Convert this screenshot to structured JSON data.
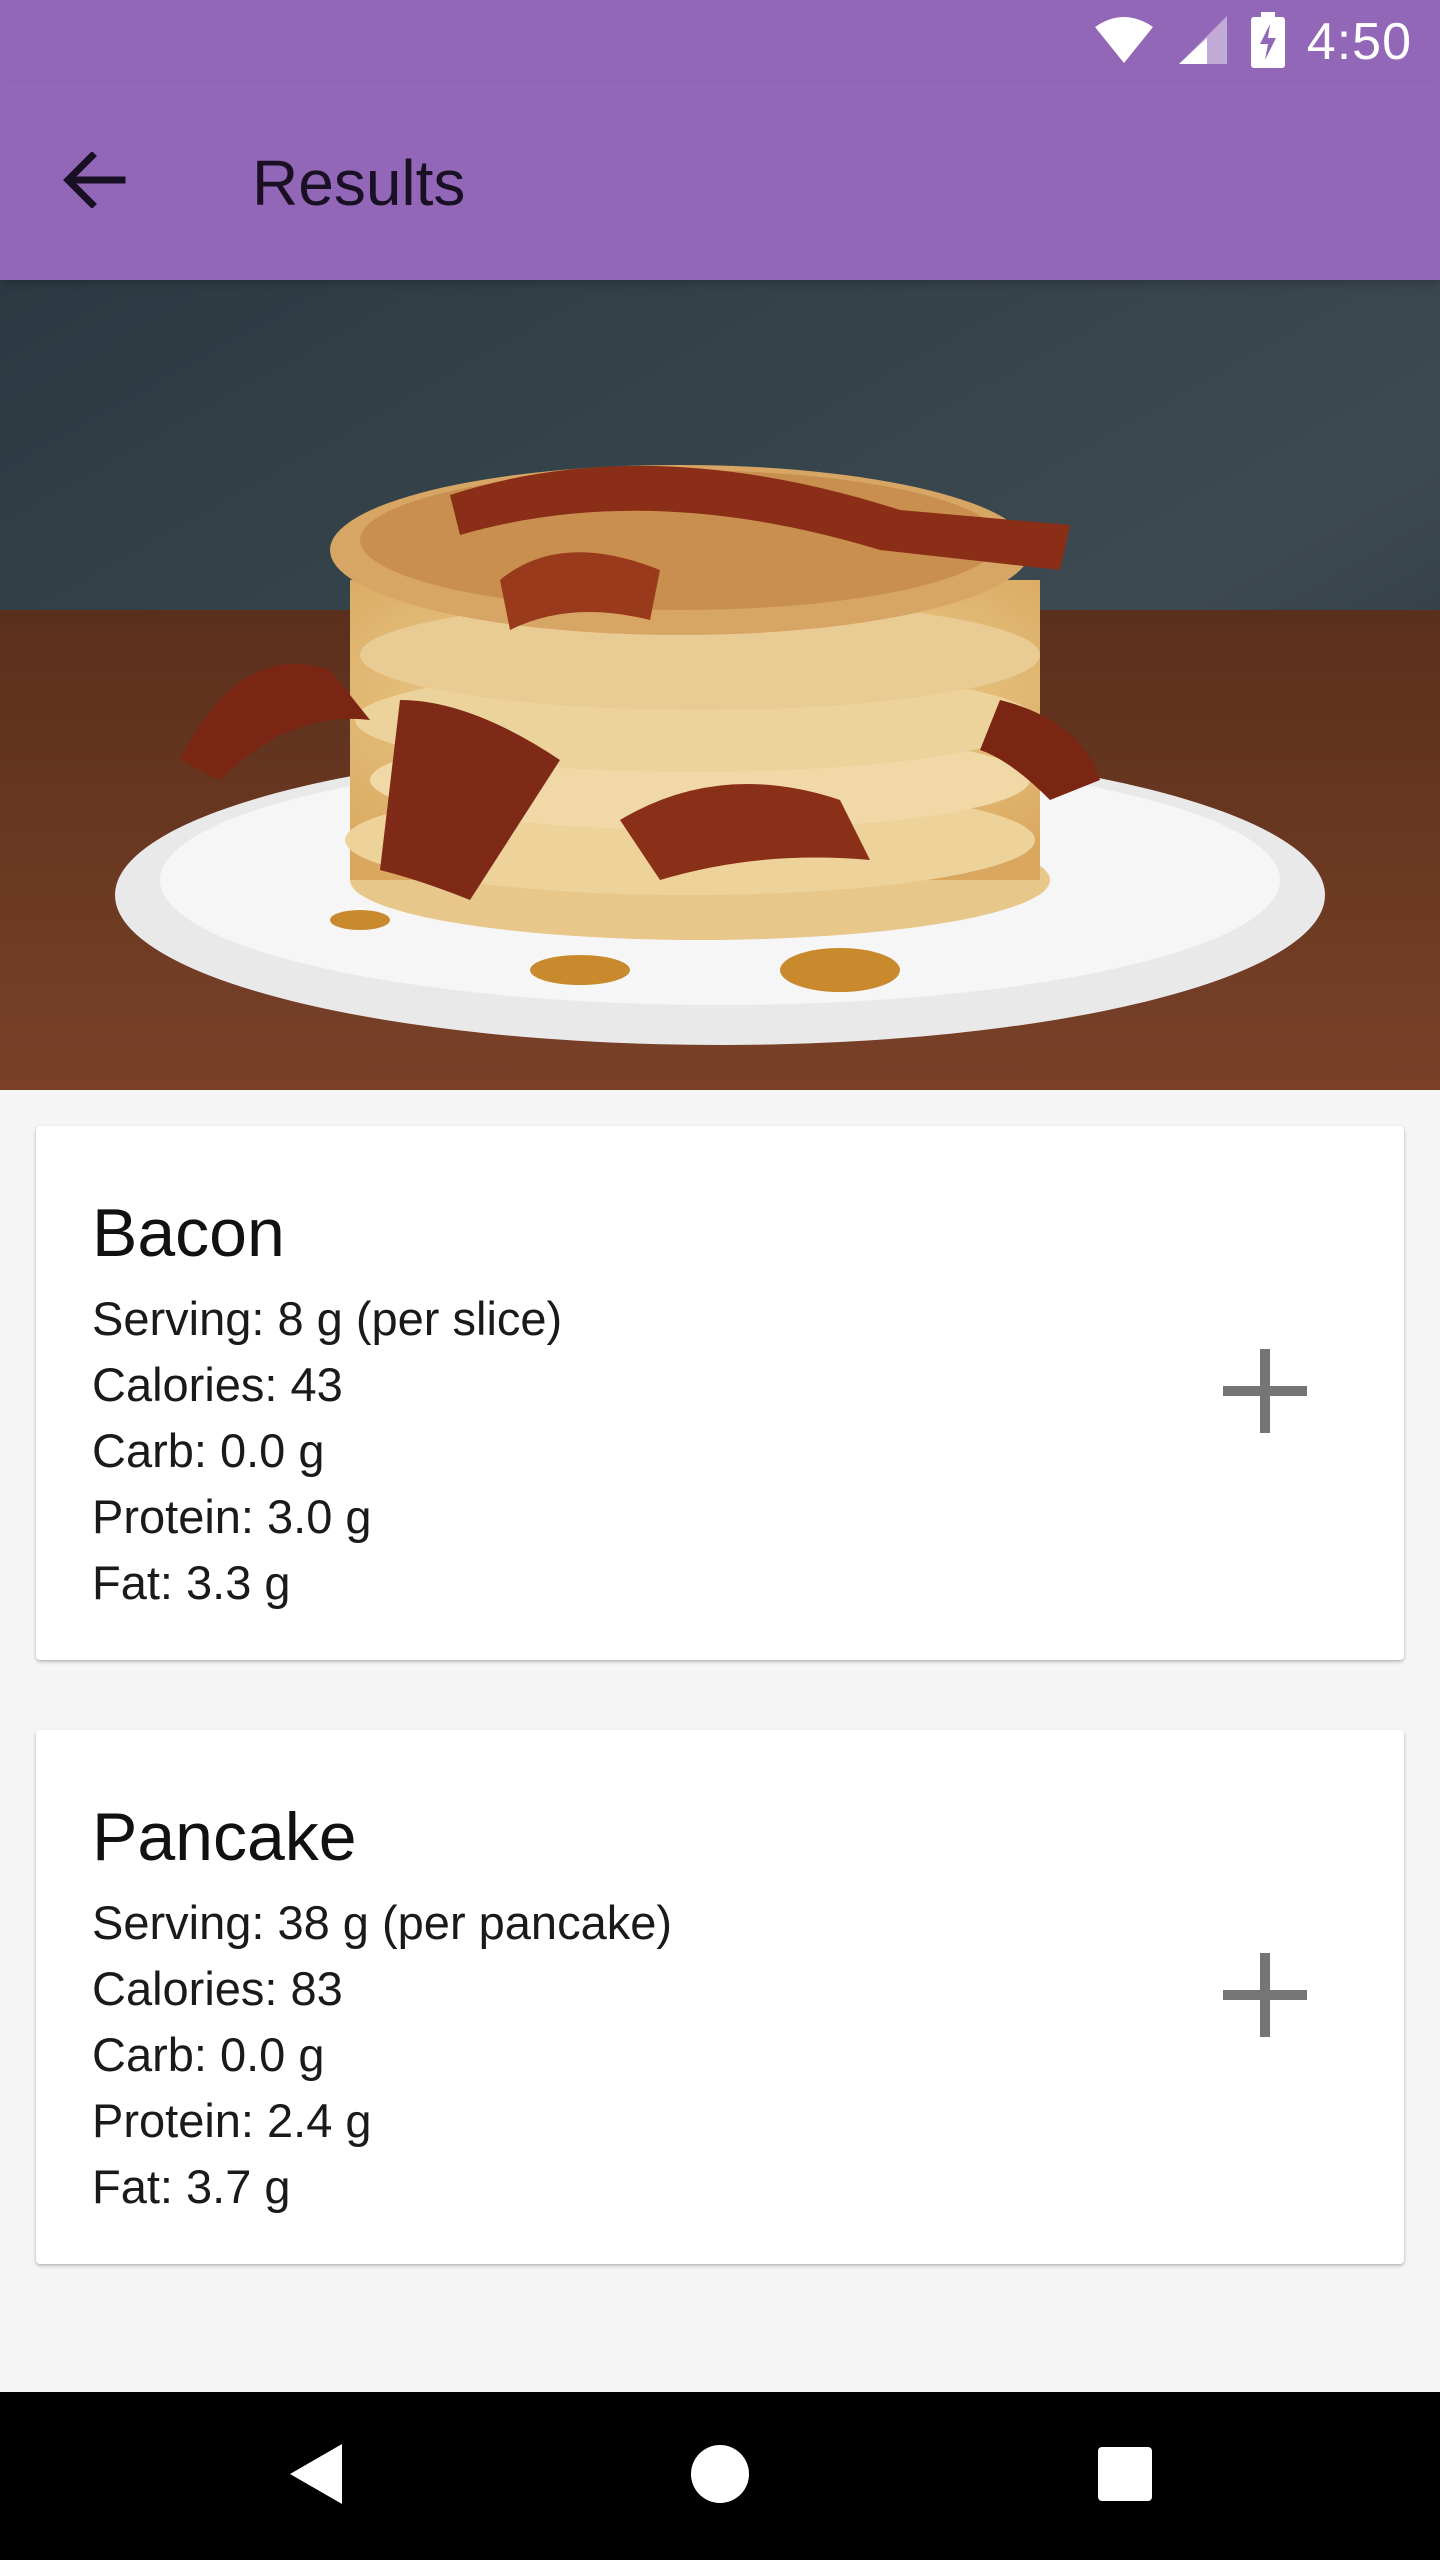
{
  "status_bar": {
    "time": "4:50"
  },
  "app_bar": {
    "title": "Results"
  },
  "hero_image": {
    "description_icon": "pancakes-with-bacon-photo"
  },
  "results": [
    {
      "name": "Bacon",
      "serving": "Serving: 8 g (per slice)",
      "calories": "Calories: 43",
      "carb": "Carb: 0.0 g",
      "protein": "Protein: 3.0 g",
      "fat": "Fat: 3.3 g"
    },
    {
      "name": "Pancake",
      "serving": "Serving: 38 g (per pancake)",
      "calories": "Calories: 83",
      "carb": "Carb: 0.0 g",
      "protein": "Protein: 2.4 g",
      "fat": "Fat: 3.7 g"
    }
  ],
  "colors": {
    "primary": "#9367b8",
    "background": "#f5f5f5",
    "card": "#ffffff",
    "add_icon": "#757575"
  },
  "icons": {
    "back": "arrow-back-icon",
    "add": "plus-icon",
    "nav_back": "triangle-back-icon",
    "nav_home": "circle-home-icon",
    "nav_recents": "square-recents-icon"
  }
}
